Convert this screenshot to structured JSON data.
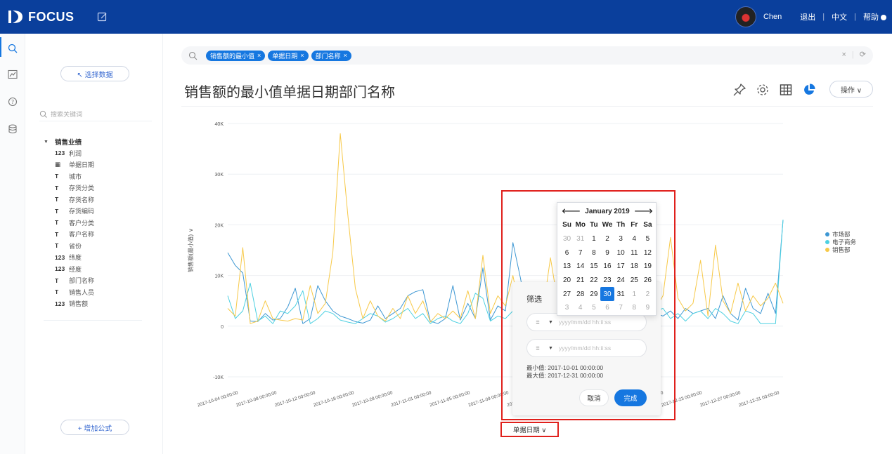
{
  "header": {
    "brand": "FOCUS",
    "user_name": "Chen",
    "logout": "退出",
    "language": "中文",
    "help": "帮助",
    "divider": "|"
  },
  "sidebar": {
    "select_data": "↖ 选择数据",
    "search_placeholder": "搜索关键词",
    "group": "销售业绩",
    "fields": [
      {
        "type": "123",
        "name": "利润"
      },
      {
        "type": "▦",
        "name": "单据日期"
      },
      {
        "type": "T",
        "name": "城市"
      },
      {
        "type": "T",
        "name": "存货分类"
      },
      {
        "type": "T",
        "name": "存货名称"
      },
      {
        "type": "T",
        "name": "存货编码"
      },
      {
        "type": "T",
        "name": "客户分类"
      },
      {
        "type": "T",
        "name": "客户名称"
      },
      {
        "type": "T",
        "name": "省份"
      },
      {
        "type": "123",
        "name": "纬度"
      },
      {
        "type": "123",
        "name": "经度"
      },
      {
        "type": "T",
        "name": "部门名称"
      },
      {
        "type": "T",
        "name": "销售人员"
      },
      {
        "type": "123",
        "name": "销售额"
      }
    ],
    "add_formula": "+ 增加公式"
  },
  "query": {
    "tags": [
      "销售额的最小值",
      "单据日期",
      "部门名称"
    ],
    "tag_close": "×",
    "clear": "×",
    "bar_divider": "|",
    "refresh": "⟳"
  },
  "page": {
    "title": "销售额的最小值单据日期部门名称",
    "operate": "操作 ∨"
  },
  "chart_data": {
    "type": "line",
    "ylabel": "销售额(最小值) ∨",
    "xlabel": "单据日期 ∨",
    "ylim": [
      -10000,
      40000
    ],
    "y_ticks": [
      "40K",
      "30K",
      "20K",
      "10K",
      "0",
      "-10K"
    ],
    "x_tick_labels": [
      "2017-10-04 00:00:00",
      "2017-10-08 00:00:00",
      "2017-10-12 00:00:00",
      "2017-10-18 00:00:00",
      "2017-10-28 00:00:00",
      "2017-11-01 00:00:00",
      "2017-11-05 00:00:00",
      "2017-11-09 00:00:00",
      "2017-11-13 00:00:00",
      "2017-11-17 00:00:00",
      "2017-11-21 00:00:00",
      "2017-12-19 00:00:00",
      "2017-12-23 00:00:00",
      "2017-12-27 00:00:00",
      "2017-12-31 00:00:00"
    ],
    "legend_position": "right",
    "series": [
      {
        "name": "市场部",
        "color": "#3d97d3",
        "values": [
          14500,
          12000,
          10500,
          1000,
          900,
          2500,
          1200,
          1500,
          3800,
          7500,
          500,
          1500,
          8000,
          5000,
          3000,
          2000,
          1500,
          900,
          600,
          1200,
          4000,
          1500,
          2500,
          3500,
          6000,
          6800,
          7200,
          1000,
          500,
          1500,
          8000,
          1200,
          4500,
          1500,
          11500,
          1200,
          4000,
          3000,
          16500,
          9500,
          1500,
          2000,
          3500,
          3000,
          2500,
          1500,
          2000,
          6000,
          2500,
          3000,
          1500,
          2000,
          4000,
          13500,
          10500,
          7500,
          6500,
          2500,
          2000,
          3000,
          1500,
          3500,
          2500,
          3000,
          3500,
          1500,
          6000,
          2500,
          1200,
          7500,
          3500,
          2500,
          6500,
          2500,
          21000
        ]
      },
      {
        "name": "电子商务",
        "color": "#4dd0e1",
        "values": [
          6000,
          1500,
          3000,
          8500,
          1000,
          2000,
          500,
          3000,
          2500,
          4000,
          7000,
          500,
          1500,
          3000,
          2500,
          1200,
          800,
          500,
          1500,
          2500,
          2000,
          800,
          1500,
          2500,
          3500,
          1500,
          2500,
          500,
          1500,
          2000,
          1000,
          500,
          2500,
          6500,
          5500,
          1000,
          2000,
          1500,
          3000,
          2500,
          500,
          2000,
          1500,
          1000,
          4000,
          1500,
          2500,
          3000,
          1000,
          2000,
          2500,
          2000,
          1500,
          3500,
          2500,
          2000,
          4000,
          3000,
          3500,
          1500,
          2500,
          1000,
          2500,
          3000,
          1500,
          3500,
          2500,
          1000,
          500,
          3000,
          2500,
          500,
          500,
          500,
          21000
        ]
      },
      {
        "name": "销售部",
        "color": "#f7c948",
        "values": [
          3500,
          2000,
          15500,
          500,
          1000,
          5000,
          1500,
          1200,
          1000,
          1500,
          1200,
          8000,
          2500,
          4500,
          14500,
          38000,
          22000,
          7500,
          1500,
          5000,
          2000,
          1000,
          3500,
          1500,
          6000,
          2500,
          5000,
          800,
          2500,
          1500,
          3000,
          1500,
          7000,
          1500,
          14000,
          2500,
          6000,
          4000,
          10000,
          2500,
          7000,
          1500,
          3000,
          13500,
          4500,
          2500,
          6000,
          2000,
          3000,
          9000,
          2500,
          5000,
          2500,
          14000,
          3000,
          1500,
          2500,
          3500,
          6000,
          17500,
          5500,
          3000,
          4500,
          13000,
          2000,
          16000,
          5000,
          2500,
          8500,
          3000,
          6000,
          4000,
          5500,
          8500,
          4500
        ]
      }
    ]
  },
  "filter": {
    "title": "筛选",
    "op1": "=",
    "op2": "=",
    "placeholder": "yyyy/mm/dd hh:ii:ss",
    "min_label": "最小值: 2017-10-01 00:00:00",
    "max_label": "最大值: 2017-12-31 00:00:00",
    "cancel": "取消",
    "done": "完成"
  },
  "calendar": {
    "month": "January 2019",
    "prev": "🡐",
    "next": "🡒",
    "dow": [
      "Su",
      "Mo",
      "Tu",
      "We",
      "Th",
      "Fr",
      "Sa"
    ],
    "weeks": [
      [
        "30",
        "31",
        "1",
        "2",
        "3",
        "4",
        "5"
      ],
      [
        "6",
        "7",
        "8",
        "9",
        "10",
        "11",
        "12"
      ],
      [
        "13",
        "14",
        "15",
        "16",
        "17",
        "18",
        "19"
      ],
      [
        "20",
        "21",
        "22",
        "23",
        "24",
        "25",
        "26"
      ],
      [
        "27",
        "28",
        "29",
        "30",
        "31",
        "1",
        "2"
      ],
      [
        "3",
        "4",
        "5",
        "6",
        "7",
        "8",
        "9"
      ]
    ],
    "selected": "30"
  },
  "colors": {
    "header": "#0a3f9c",
    "accent": "#1677e0",
    "highlight": "#e0201c"
  }
}
